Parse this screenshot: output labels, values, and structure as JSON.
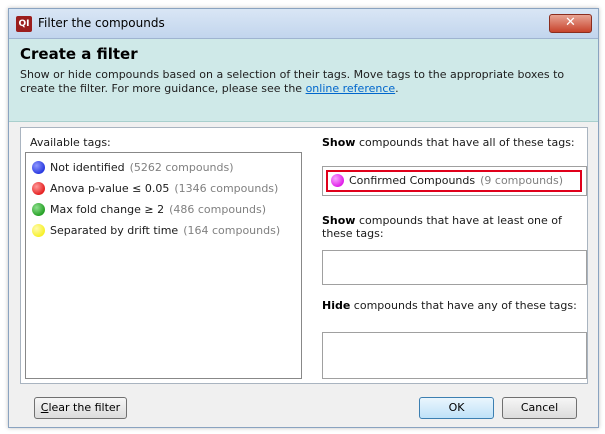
{
  "window": {
    "app_icon_text": "QI",
    "title": "Filter the compounds",
    "close_label": "✕"
  },
  "header": {
    "title": "Create a filter",
    "description_before_link": "Show or hide compounds based on a selection of their tags. Move tags to the appropriate boxes to create the filter. For more guidance, please see the ",
    "link_text": "online reference",
    "description_after_link": "."
  },
  "available": {
    "label": "Available tags:",
    "items": [
      {
        "name": "Not identified",
        "count": "(5262 compounds)",
        "color": "#2a3ae0"
      },
      {
        "name": "Anova p-value ≤ 0.05",
        "count": "(1346 compounds)",
        "color": "#e52222"
      },
      {
        "name": "Max fold change ≥ 2",
        "count": "(486 compounds)",
        "color": "#27a127"
      },
      {
        "name": "Separated by drift time",
        "count": "(164 compounds)",
        "color": "#f7f02a"
      }
    ]
  },
  "show_all": {
    "label_bold": "Show",
    "label_rest": " compounds that have all of these tags:",
    "items": [
      {
        "name": "Confirmed Compounds",
        "count": "(9 compounds)",
        "color": "#e020e8"
      }
    ]
  },
  "show_any": {
    "label_bold": "Show",
    "label_rest": " compounds that have at least one of these tags:"
  },
  "hide_any": {
    "label_bold": "Hide",
    "label_rest": " compounds that have any of these tags:"
  },
  "footer": {
    "clear_first_letter": "C",
    "clear_rest": "lear the filter",
    "ok_label": "OK",
    "cancel_label": "Cancel"
  },
  "colors": {
    "highlight_border": "#e0001b",
    "header_bg": "#cfe9e8"
  }
}
